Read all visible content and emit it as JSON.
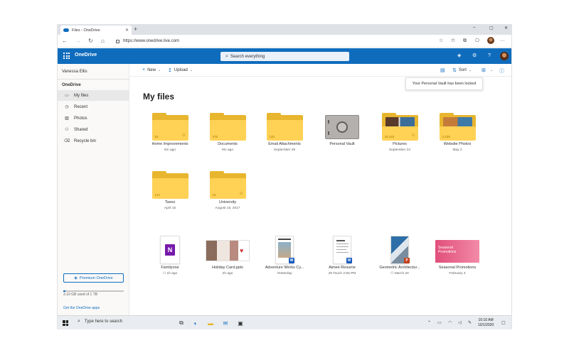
{
  "browser": {
    "tab_title": "Files - OneDrive",
    "tab_close": "✕",
    "new_tab": "+",
    "url": "https://www.onedrive.live.com",
    "window_controls": {
      "minimize": "–",
      "maximize": "▢",
      "close": "✕"
    },
    "toolbar_more": "···"
  },
  "header": {
    "brand": "OneDrive",
    "search_placeholder": "Search everything",
    "help": "?"
  },
  "sidebar": {
    "user_name": "Vanessa Ellis",
    "section": "OneDrive",
    "items": [
      {
        "label": "My files",
        "icon": "folder-icon",
        "active": true
      },
      {
        "label": "Recent",
        "icon": "clock-icon"
      },
      {
        "label": "Photos",
        "icon": "image-icon"
      },
      {
        "label": "Shared",
        "icon": "people-icon"
      },
      {
        "label": "Recycle bin",
        "icon": "trash-icon"
      }
    ],
    "premium_label": "Premium OneDrive",
    "storage_text": "3.10 GB used of 1 TB",
    "storage_fraction": 0.0031,
    "get_apps": "Get the OneDrive apps"
  },
  "commandbar": {
    "new": "New",
    "upload": "Upload",
    "sort": "Sort"
  },
  "tooltip": "Your Personal Vault has been locked",
  "page_title": "My files",
  "folders": [
    {
      "name": "Home Improvements",
      "meta": "8m ago",
      "count": "53",
      "shared": true
    },
    {
      "name": "Documents",
      "meta": "9m ago",
      "count": "476",
      "shared": false
    },
    {
      "name": "Email Attachments",
      "meta": "September 29",
      "count": "120",
      "shared": false
    },
    {
      "name": "Personal Vault",
      "meta": ""
    },
    {
      "name": "Pictures",
      "meta": "September 24",
      "count": "43,153",
      "shared": true
    },
    {
      "name": "Website Photos",
      "meta": "May 2",
      "count": "3,106",
      "shared": false
    },
    {
      "name": "Taxes",
      "meta": "April 15",
      "count": "124",
      "shared": false
    },
    {
      "name": "University",
      "meta": "August 15, 2017",
      "count": "15",
      "shared": true
    }
  ],
  "files": [
    {
      "name": "Familyone",
      "meta": "1h ago",
      "badge": "N",
      "badge_color": "#7719aa"
    },
    {
      "name": "Holiday Card.pptx",
      "meta": "2h ago",
      "badge": "P",
      "badge_color": "#c43e1c"
    },
    {
      "name": "Adventure Works Cy...",
      "meta": "Yesterday",
      "badge": "W",
      "badge_color": "#185abd"
    },
    {
      "name": "Aimee Resume",
      "meta": "29 Touch 2:55 PM",
      "badge": "W",
      "badge_color": "#185abd"
    },
    {
      "name": "Geometric Architectur...",
      "meta": "March 20",
      "badge": "P",
      "badge_color": "#c43e1c"
    },
    {
      "name": "Seasonal Promotions",
      "meta": "February 4",
      "badge": "P",
      "badge_color": "#c43e1c"
    }
  ],
  "file_art": {
    "seasonal_title": "Seasonal Promotions"
  },
  "taskbar": {
    "search_placeholder": "Type here to search",
    "time": "10:10 AM",
    "date": "10/1/2020"
  },
  "colors": {
    "accent": "#0f6cbd",
    "folder": "#ffd155",
    "folder_back": "#e8b52e"
  }
}
